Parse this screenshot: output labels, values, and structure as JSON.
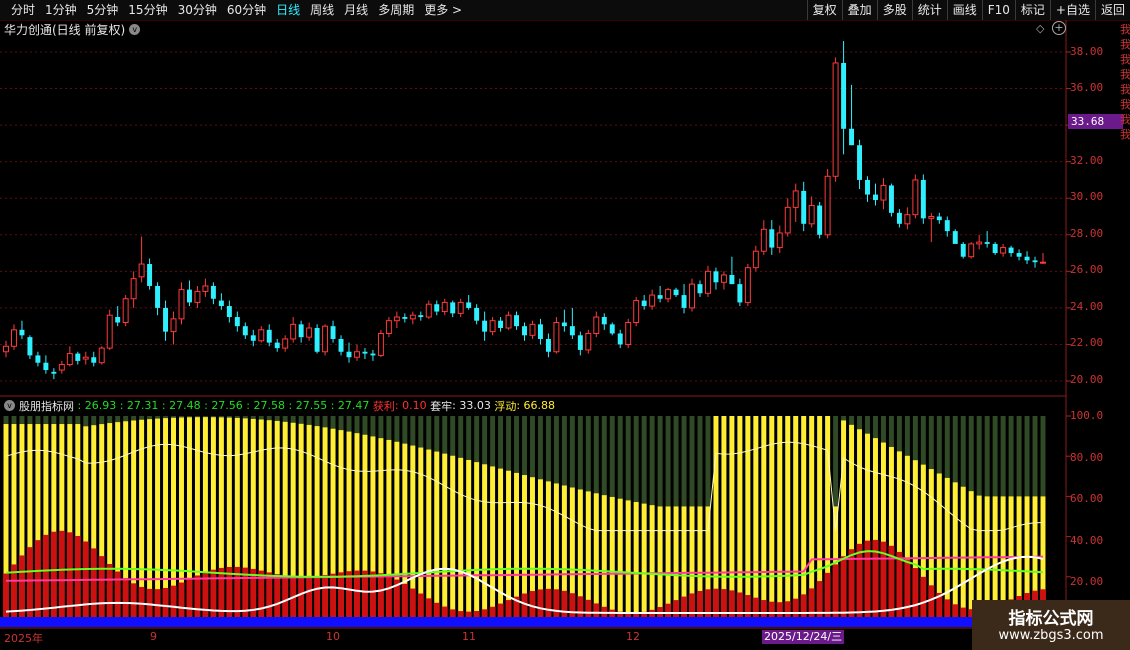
{
  "toolbar": {
    "periods": [
      "分时",
      "1分钟",
      "5分钟",
      "15分钟",
      "30分钟",
      "60分钟",
      "日线",
      "周线",
      "月线",
      "多周期",
      "更多"
    ],
    "more_arrow": ">",
    "active_period": "日线",
    "right_buttons": [
      "复权",
      "叠加",
      "多股",
      "统计",
      "画线",
      "F10",
      "标记",
      "+自选",
      "返回"
    ]
  },
  "title": {
    "text": "华力创通(日线 前复权)",
    "chevron": "v"
  },
  "price_axis": {
    "labels": [
      "38.00",
      "36.00",
      "34.00",
      "32.00",
      "30.00",
      "28.00",
      "26.00",
      "24.00",
      "22.00",
      "20.00"
    ],
    "current_price_tag": "33.68"
  },
  "indicator": {
    "name": "股朋指标网",
    "values": [
      "26.93",
      "27.31",
      "27.48",
      "27.56",
      "27.58",
      "27.55",
      "27.47"
    ],
    "profit_label": "获利",
    "profit_value": "0.10",
    "trapped_label": "套牢",
    "trapped_value": "33.03",
    "float_label": "浮动",
    "float_value": "66.88",
    "axis_labels": [
      "100.0",
      "80.00",
      "60.00",
      "40.00",
      "20.00"
    ]
  },
  "dates": {
    "year_label": "2025年",
    "months": [
      "9",
      "10",
      "11",
      "12"
    ],
    "cursor_date": "2025/12/24/三"
  },
  "watermark": {
    "title": "指标公式网",
    "url": "www.zbgs3.com"
  },
  "colors": {
    "up": "#ff3a3a",
    "down": "#2ff0ff",
    "yellow": "#ffee33",
    "red_area": "#cc1111",
    "blue_base": "#1010ff"
  },
  "chart_data": {
    "type": "candlestick",
    "title": "华力创通(日线 前复权)",
    "ylim": [
      19.5,
      39.5
    ],
    "ohlc": [
      [
        21.6,
        22.2,
        21.3,
        21.9
      ],
      [
        21.9,
        23.1,
        21.7,
        22.8
      ],
      [
        22.8,
        23.3,
        22.3,
        22.5
      ],
      [
        22.4,
        22.5,
        21.2,
        21.4
      ],
      [
        21.4,
        21.6,
        20.8,
        21.0
      ],
      [
        21.0,
        21.4,
        20.4,
        20.6
      ],
      [
        20.5,
        20.7,
        20.1,
        20.4
      ],
      [
        20.6,
        21.1,
        20.4,
        20.9
      ],
      [
        20.9,
        21.9,
        20.8,
        21.5
      ],
      [
        21.5,
        21.6,
        20.9,
        21.1
      ],
      [
        21.2,
        21.6,
        20.9,
        21.3
      ],
      [
        21.3,
        21.6,
        20.8,
        21.0
      ],
      [
        21.0,
        21.9,
        20.9,
        21.8
      ],
      [
        21.8,
        23.9,
        21.7,
        23.6
      ],
      [
        23.5,
        24.1,
        23.0,
        23.2
      ],
      [
        23.2,
        24.7,
        23.0,
        24.5
      ],
      [
        24.5,
        26.0,
        24.0,
        25.6
      ],
      [
        25.7,
        27.9,
        25.4,
        26.4
      ],
      [
        26.4,
        26.7,
        25.0,
        25.2
      ],
      [
        25.2,
        25.4,
        23.6,
        24.0
      ],
      [
        24.0,
        24.4,
        22.2,
        22.7
      ],
      [
        22.7,
        23.8,
        22.0,
        23.4
      ],
      [
        23.4,
        25.4,
        23.1,
        25.0
      ],
      [
        25.0,
        25.5,
        24.1,
        24.3
      ],
      [
        24.3,
        25.2,
        24.0,
        24.9
      ],
      [
        24.9,
        25.6,
        24.6,
        25.2
      ],
      [
        25.2,
        25.4,
        24.2,
        24.5
      ],
      [
        24.4,
        24.8,
        23.9,
        24.1
      ],
      [
        24.1,
        24.4,
        23.2,
        23.5
      ],
      [
        23.5,
        23.8,
        22.7,
        23.0
      ],
      [
        23.0,
        23.2,
        22.3,
        22.5
      ],
      [
        22.5,
        22.8,
        21.9,
        22.2
      ],
      [
        22.2,
        23.0,
        22.1,
        22.8
      ],
      [
        22.8,
        23.1,
        21.9,
        22.1
      ],
      [
        22.1,
        22.3,
        21.6,
        21.8
      ],
      [
        21.8,
        22.5,
        21.6,
        22.3
      ],
      [
        22.3,
        23.5,
        22.1,
        23.1
      ],
      [
        23.1,
        23.3,
        22.1,
        22.4
      ],
      [
        22.4,
        23.2,
        22.2,
        22.9
      ],
      [
        22.9,
        23.1,
        21.5,
        21.6
      ],
      [
        21.6,
        23.1,
        21.4,
        23.0
      ],
      [
        23.0,
        23.3,
        22.1,
        22.3
      ],
      [
        22.3,
        22.5,
        21.4,
        21.6
      ],
      [
        21.6,
        22.1,
        21.0,
        21.3
      ],
      [
        21.3,
        22.0,
        21.1,
        21.6
      ],
      [
        21.6,
        21.8,
        21.2,
        21.5
      ],
      [
        21.5,
        21.7,
        21.1,
        21.4
      ],
      [
        21.4,
        22.8,
        21.3,
        22.6
      ],
      [
        22.6,
        23.5,
        22.4,
        23.3
      ],
      [
        23.3,
        23.8,
        22.9,
        23.5
      ],
      [
        23.5,
        23.7,
        23.2,
        23.4
      ],
      [
        23.4,
        23.8,
        23.1,
        23.6
      ],
      [
        23.6,
        23.8,
        23.3,
        23.5
      ],
      [
        23.5,
        24.4,
        23.4,
        24.2
      ],
      [
        24.2,
        24.4,
        23.6,
        23.8
      ],
      [
        23.8,
        24.5,
        23.6,
        24.3
      ],
      [
        24.3,
        24.4,
        23.5,
        23.7
      ],
      [
        23.7,
        24.5,
        23.5,
        24.3
      ],
      [
        24.3,
        24.7,
        23.9,
        24.0
      ],
      [
        24.0,
        24.2,
        23.1,
        23.3
      ],
      [
        23.3,
        23.8,
        22.2,
        22.7
      ],
      [
        22.7,
        23.5,
        22.5,
        23.3
      ],
      [
        23.3,
        23.5,
        22.7,
        22.9
      ],
      [
        22.9,
        23.8,
        22.8,
        23.6
      ],
      [
        23.6,
        23.8,
        22.8,
        23.0
      ],
      [
        23.0,
        23.2,
        22.2,
        22.5
      ],
      [
        22.5,
        23.3,
        22.3,
        23.1
      ],
      [
        23.1,
        23.4,
        22.0,
        22.3
      ],
      [
        22.3,
        22.6,
        21.3,
        21.6
      ],
      [
        21.6,
        23.5,
        21.5,
        23.2
      ],
      [
        23.2,
        23.9,
        22.7,
        23.0
      ],
      [
        23.0,
        24.0,
        22.3,
        22.5
      ],
      [
        22.5,
        22.7,
        21.4,
        21.7
      ],
      [
        21.7,
        22.8,
        21.5,
        22.6
      ],
      [
        22.6,
        23.8,
        22.4,
        23.5
      ],
      [
        23.5,
        23.7,
        22.8,
        23.1
      ],
      [
        23.1,
        23.2,
        22.5,
        22.6
      ],
      [
        22.6,
        22.8,
        21.8,
        22.0
      ],
      [
        22.0,
        23.4,
        21.8,
        23.2
      ],
      [
        23.2,
        24.6,
        23.0,
        24.4
      ],
      [
        24.4,
        24.7,
        23.9,
        24.1
      ],
      [
        24.1,
        25.0,
        23.9,
        24.7
      ],
      [
        24.7,
        25.2,
        24.3,
        24.5
      ],
      [
        24.5,
        25.1,
        24.3,
        25.0
      ],
      [
        25.0,
        25.1,
        24.6,
        24.7
      ],
      [
        24.7,
        25.3,
        23.7,
        24.0
      ],
      [
        24.0,
        25.6,
        23.8,
        25.3
      ],
      [
        25.3,
        25.5,
        24.6,
        24.8
      ],
      [
        24.8,
        26.3,
        24.6,
        26.0
      ],
      [
        26.0,
        26.2,
        25.0,
        25.4
      ],
      [
        25.4,
        26.0,
        25.0,
        25.8
      ],
      [
        25.8,
        26.8,
        25.6,
        25.3
      ],
      [
        25.3,
        25.6,
        24.1,
        24.3
      ],
      [
        24.3,
        26.4,
        24.1,
        26.2
      ],
      [
        26.2,
        27.4,
        26.0,
        27.1
      ],
      [
        27.1,
        28.8,
        26.9,
        28.3
      ],
      [
        28.3,
        28.8,
        26.9,
        27.3
      ],
      [
        27.3,
        28.5,
        27.0,
        28.1
      ],
      [
        28.1,
        30.0,
        27.9,
        29.5
      ],
      [
        29.5,
        30.8,
        28.7,
        30.4
      ],
      [
        30.4,
        30.9,
        28.2,
        28.6
      ],
      [
        28.6,
        30.1,
        28.4,
        29.6
      ],
      [
        29.6,
        29.8,
        27.8,
        28.0
      ],
      [
        28.0,
        31.6,
        27.8,
        31.2
      ],
      [
        31.2,
        37.7,
        30.9,
        37.4
      ],
      [
        37.4,
        38.6,
        32.4,
        33.8
      ],
      [
        33.8,
        36.2,
        32.9,
        32.9
      ],
      [
        32.9,
        33.2,
        30.5,
        31.0
      ],
      [
        31.0,
        31.2,
        29.8,
        30.2
      ],
      [
        30.2,
        30.8,
        29.6,
        29.9
      ],
      [
        29.9,
        31.1,
        29.4,
        30.7
      ],
      [
        30.7,
        30.8,
        29.0,
        29.2
      ],
      [
        29.2,
        29.4,
        28.4,
        28.6
      ],
      [
        28.6,
        29.5,
        28.3,
        29.1
      ],
      [
        29.1,
        31.3,
        28.9,
        31.0
      ],
      [
        31.0,
        31.3,
        28.6,
        28.9
      ],
      [
        28.9,
        29.2,
        27.6,
        29.0
      ],
      [
        29.0,
        29.2,
        28.6,
        28.8
      ],
      [
        28.8,
        29.0,
        27.9,
        28.2
      ],
      [
        28.2,
        28.3,
        27.6,
        27.5
      ],
      [
        27.5,
        27.6,
        26.7,
        26.8
      ],
      [
        26.8,
        27.6,
        26.7,
        27.5
      ],
      [
        27.5,
        28.0,
        27.2,
        27.6
      ],
      [
        27.6,
        28.2,
        27.3,
        27.5
      ],
      [
        27.5,
        27.6,
        26.9,
        27.0
      ],
      [
        27.0,
        27.5,
        26.8,
        27.3
      ],
      [
        27.3,
        27.4,
        26.8,
        27.0
      ],
      [
        27.0,
        27.2,
        26.6,
        26.8
      ],
      [
        26.8,
        27.1,
        26.4,
        26.6
      ],
      [
        26.6,
        26.8,
        26.2,
        26.5
      ],
      [
        26.5,
        27.0,
        26.4,
        26.5
      ]
    ]
  }
}
